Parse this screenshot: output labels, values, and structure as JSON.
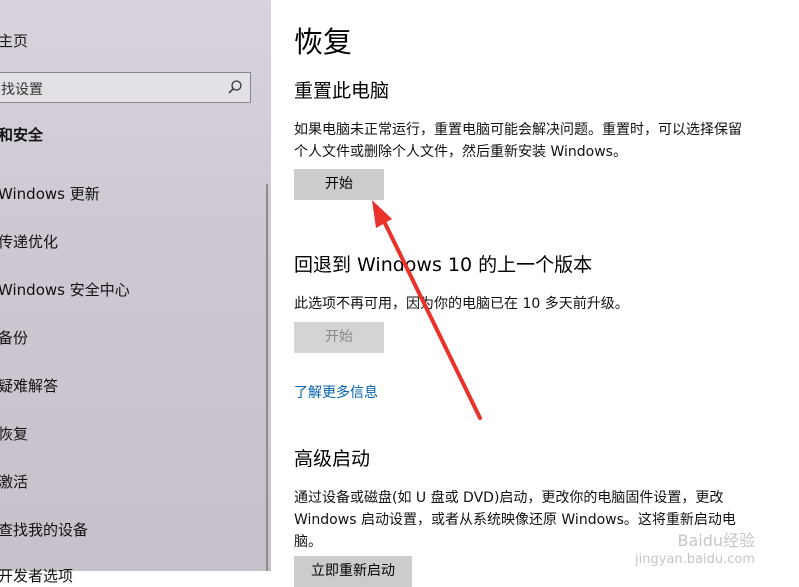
{
  "sidebar": {
    "home": "主页",
    "search_placeholder": "找设置",
    "section_title": "和安全",
    "items": [
      {
        "label": "Windows 更新"
      },
      {
        "label": "传递优化"
      },
      {
        "label": "Windows 安全中心"
      },
      {
        "label": "备份"
      },
      {
        "label": "疑难解答"
      },
      {
        "label": "恢复"
      },
      {
        "label": "激活"
      },
      {
        "label": "查找我的设备"
      },
      {
        "label": "开发者选项"
      }
    ]
  },
  "main": {
    "title": "恢复",
    "reset": {
      "title": "重置此电脑",
      "description": "如果电脑未正常运行，重置电脑可能会解决问题。重置时，可以选择保留个人文件或删除个人文件，然后重新安装 Windows。",
      "button": "开始"
    },
    "rollback": {
      "title": "回退到 Windows 10 的上一个版本",
      "description": "此选项不再可用，因为你的电脑已在 10 多天前升级。",
      "button": "开始",
      "link": "了解更多信息"
    },
    "advanced": {
      "title": "高级启动",
      "description": "通过设备或磁盘(如 U 盘或 DVD)启动，更改你的电脑固件设置，更改 Windows 启动设置，或者从系统映像还原 Windows。这将重新启动电脑。",
      "button": "立即重新启动"
    }
  },
  "watermark": {
    "text": "Baidu经验",
    "sub": "jingyan.baidu.com"
  },
  "colors": {
    "accent_link": "#0063b1",
    "annotation_arrow": "#e8322a"
  }
}
